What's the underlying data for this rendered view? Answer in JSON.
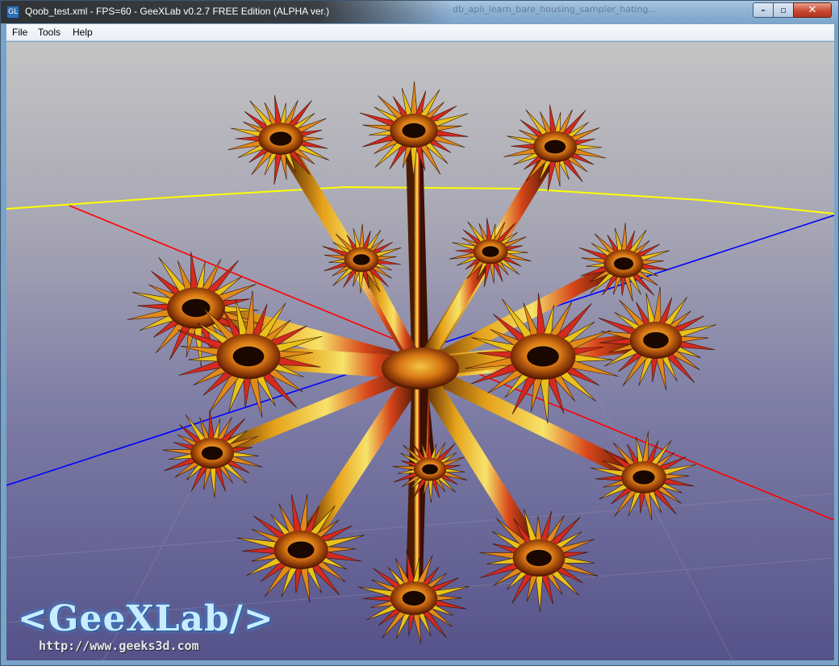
{
  "window": {
    "title": "Qoob_test.xml - FPS=60 - GeeXLab v0.2.7 FREE Edition (ALPHA ver.)",
    "icon_label": "GL",
    "background_window_text": "db_apli_learn_bare_housing_sampler_hating...",
    "controls": {
      "minimize": "–",
      "maximize": "▫",
      "close": "✕"
    }
  },
  "menu": [
    {
      "label": "File",
      "accel": "F"
    },
    {
      "label": "Tools",
      "accel": "T"
    },
    {
      "label": "Help",
      "accel": "H"
    }
  ],
  "viewport": {
    "logo_text": "<GeeXLab/>",
    "url_text": "http://www.geeks3d.com",
    "colors": {
      "axis_x": "#ff0000",
      "axis_y": "#ffff00",
      "axis_z": "#0000ff",
      "shape_orange": "#e08a1a",
      "shape_red": "#d42a1f",
      "shape_yellow": "#e8c21a"
    }
  }
}
